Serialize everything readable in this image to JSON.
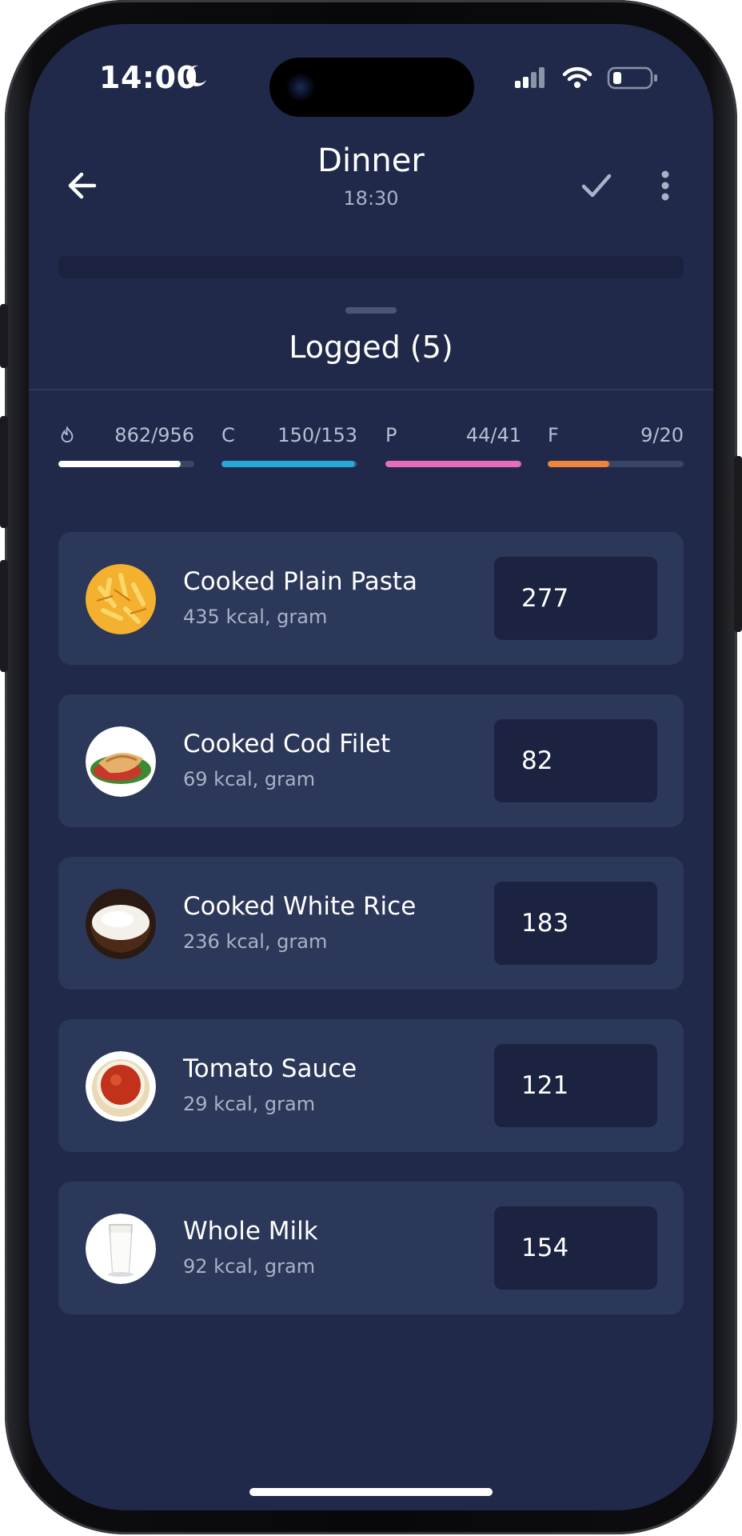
{
  "status_bar": {
    "time": "14:00"
  },
  "header": {
    "title": "Dinner",
    "time": "18:30"
  },
  "logged": {
    "title": "Logged (5)"
  },
  "macros": [
    {
      "id": "calories",
      "label": "",
      "value": "862/956",
      "progress": 0.9,
      "color": "#ffffff"
    },
    {
      "id": "carbs",
      "label": "C",
      "value": "150/153",
      "progress": 0.98,
      "color": "#27a7d8"
    },
    {
      "id": "protein",
      "label": "P",
      "value": "44/41",
      "progress": 1.0,
      "color": "#e96bbd"
    },
    {
      "id": "fat",
      "label": "F",
      "value": "9/20",
      "progress": 0.45,
      "color": "#f0843c"
    }
  ],
  "foods": [
    {
      "name": "Cooked Plain Pasta",
      "meta": "435 kcal, gram",
      "quantity": "277",
      "image": "pasta"
    },
    {
      "name": "Cooked Cod Filet",
      "meta": "69 kcal, gram",
      "quantity": "82",
      "image": "cod"
    },
    {
      "name": "Cooked White Rice",
      "meta": "236 kcal, gram",
      "quantity": "183",
      "image": "rice"
    },
    {
      "name": "Tomato Sauce",
      "meta": "29 kcal, gram",
      "quantity": "121",
      "image": "sauce"
    },
    {
      "name": "Whole Milk",
      "meta": "92 kcal, gram",
      "quantity": "154",
      "image": "milk"
    }
  ]
}
